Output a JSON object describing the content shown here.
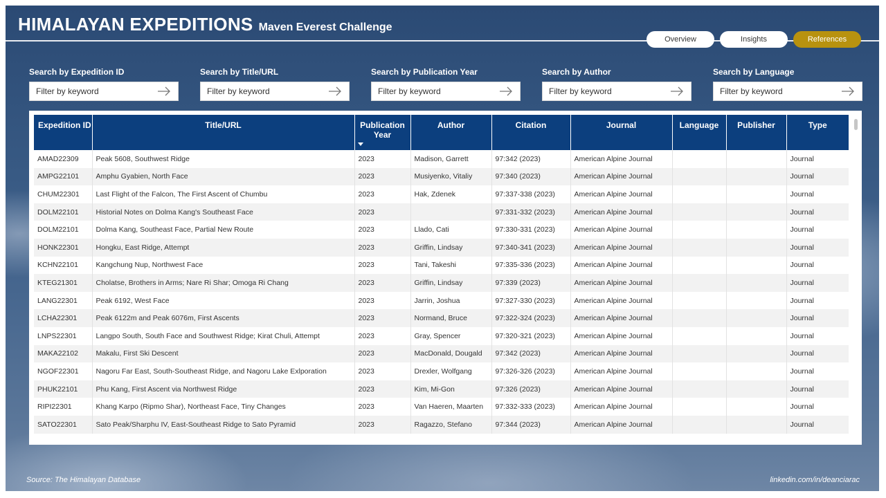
{
  "header": {
    "title": "HIMALAYAN EXPEDITIONS",
    "subtitle": "Maven Everest Challenge"
  },
  "nav": {
    "tabs": [
      {
        "label": "Overview",
        "active": false
      },
      {
        "label": "Insights",
        "active": false
      },
      {
        "label": "References",
        "active": true
      }
    ],
    "active_color": "#b8920f"
  },
  "filters": [
    {
      "label": "Search by Expedition ID",
      "placeholder": "Filter by keyword"
    },
    {
      "label": "Search by Title/URL",
      "placeholder": "Filter by keyword"
    },
    {
      "label": "Search by Publication Year",
      "placeholder": "Filter by keyword"
    },
    {
      "label": "Search by Author",
      "placeholder": "Filter by keyword"
    },
    {
      "label": "Search by Language",
      "placeholder": "Filter by keyword"
    }
  ],
  "table": {
    "header_color": "#0c3f7e",
    "columns": [
      "Expedition ID",
      "Title/URL",
      "Publication Year",
      "Author",
      "Citation",
      "Journal",
      "Language",
      "Publisher",
      "Type"
    ],
    "sorted_column": "Publication Year",
    "rows": [
      [
        "AMAD22309",
        "Peak 5608, Southwest Ridge",
        "2023",
        "Madison, Garrett",
        "97:342 (2023)",
        "American Alpine Journal",
        "",
        "",
        "Journal"
      ],
      [
        "AMPG22101",
        "Amphu Gyabien, North Face",
        "2023",
        "Musiyenko, Vitaliy",
        "97:340 (2023)",
        "American Alpine Journal",
        "",
        "",
        "Journal"
      ],
      [
        "CHUM22301",
        "Last Flight of the Falcon, The First Ascent of Chumbu",
        "2023",
        "Hak, Zdenek",
        "97:337-338 (2023)",
        "American Alpine Journal",
        "",
        "",
        "Journal"
      ],
      [
        "DOLM22101",
        "Historial Notes on Dolma Kang's Southeast Face",
        "2023",
        "",
        "97:331-332 (2023)",
        "American Alpine Journal",
        "",
        "",
        "Journal"
      ],
      [
        "DOLM22101",
        "Dolma Kang, Southeast Face, Partial New Route",
        "2023",
        "Llado, Cati",
        "97:330-331 (2023)",
        "American Alpine Journal",
        "",
        "",
        "Journal"
      ],
      [
        "HONK22301",
        "Hongku, East Ridge, Attempt",
        "2023",
        "Griffin, Lindsay",
        "97:340-341 (2023)",
        "American Alpine Journal",
        "",
        "",
        "Journal"
      ],
      [
        "KCHN22101",
        "Kangchung Nup, Northwest Face",
        "2023",
        "Tani, Takeshi",
        "97:335-336 (2023)",
        "American Alpine Journal",
        "",
        "",
        "Journal"
      ],
      [
        "KTEG21301",
        "Cholatse, Brothers in Arms; Nare Ri Shar; Omoga Ri Chang",
        "2023",
        "Griffin, Lindsay",
        "97:339 (2023)",
        "American Alpine Journal",
        "",
        "",
        "Journal"
      ],
      [
        "LANG22301",
        "Peak 6192, West Face",
        "2023",
        "Jarrin, Joshua",
        "97:327-330 (2023)",
        "American Alpine Journal",
        "",
        "",
        "Journal"
      ],
      [
        "LCHA22301",
        "Peak 6122m and Peak 6076m, First Ascents",
        "2023",
        "Normand, Bruce",
        "97:322-324 (2023)",
        "American Alpine Journal",
        "",
        "",
        "Journal"
      ],
      [
        "LNPS22301",
        "Langpo South, South Face and Southwest Ridge; Kirat Chuli, Attempt",
        "2023",
        "Gray, Spencer",
        "97:320-321 (2023)",
        "American Alpine Journal",
        "",
        "",
        "Journal"
      ],
      [
        "MAKA22102",
        "Makalu, First Ski Descent",
        "2023",
        "MacDonald, Dougald",
        "97:342 (2023)",
        "American Alpine Journal",
        "",
        "",
        "Journal"
      ],
      [
        "NGOF22301",
        "Nagoru Far East, South-Southeast Ridge, and Nagoru Lake Exlporation",
        "2023",
        "Drexler, Wolfgang",
        "97:326-326 (2023)",
        "American Alpine Journal",
        "",
        "",
        "Journal"
      ],
      [
        "PHUK22101",
        "Phu Kang, First Ascent via Northwest Ridge",
        "2023",
        "Kim, Mi-Gon",
        "97:326 (2023)",
        "American Alpine Journal",
        "",
        "",
        "Journal"
      ],
      [
        "RIPI22301",
        "Khang Karpo (Ripmo Shar), Northeast Face, Tiny Changes",
        "2023",
        "Van Haeren, Maarten",
        "97:332-333 (2023)",
        "American Alpine Journal",
        "",
        "",
        "Journal"
      ],
      [
        "SATO22301",
        "Sato Peak/Sharphu IV, East-Southeast Ridge to Sato Pyramid",
        "2023",
        "Ragazzo, Stefano",
        "97:344 (2023)",
        "American Alpine Journal",
        "",
        "",
        "Journal"
      ]
    ]
  },
  "footer": {
    "source": "Source: The Himalayan Database",
    "credit": "linkedin.com/in/deanciarac"
  }
}
